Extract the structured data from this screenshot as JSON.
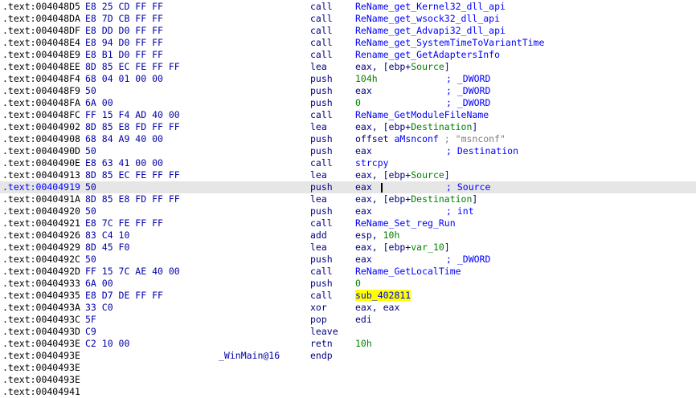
{
  "lines": [
    {
      "addr": ".text:004048D5",
      "bytes": "E8 25 CD FF FF",
      "mnem": "call",
      "ops": [
        {
          "t": "ReName_get_Kernel32_dll_api",
          "c": "blue"
        }
      ]
    },
    {
      "addr": ".text:004048DA",
      "bytes": "E8 7D CB FF FF",
      "mnem": "call",
      "ops": [
        {
          "t": "ReName_get_wsock32_dll_api",
          "c": "blue"
        }
      ]
    },
    {
      "addr": ".text:004048DF",
      "bytes": "E8 DD D0 FF FF",
      "mnem": "call",
      "ops": [
        {
          "t": "ReName_get_Advapi32_dll_api",
          "c": "blue"
        }
      ]
    },
    {
      "addr": ".text:004048E4",
      "bytes": "E8 94 D0 FF FF",
      "mnem": "call",
      "ops": [
        {
          "t": "ReName_get_SystemTimeToVariantTime",
          "c": "blue"
        }
      ]
    },
    {
      "addr": ".text:004048E9",
      "bytes": "E8 B1 D0 FF FF",
      "mnem": "call",
      "ops": [
        {
          "t": "Rename_get_GetAdaptersInfo",
          "c": "blue"
        }
      ]
    },
    {
      "addr": ".text:004048EE",
      "bytes": "8D 85 EC FE FF FF",
      "mnem": "lea",
      "ops": [
        {
          "t": "eax, [ebp+"
        },
        {
          "t": "Source",
          "c": "green"
        },
        {
          "t": "]"
        }
      ]
    },
    {
      "addr": ".text:004048F4",
      "bytes": "68 04 01 00 00",
      "mnem": "push",
      "ops": [
        {
          "t": "104h",
          "c": "green"
        }
      ],
      "cmt": "; _DWORD"
    },
    {
      "addr": ".text:004048F9",
      "bytes": "50",
      "mnem": "push",
      "ops": [
        {
          "t": "eax"
        }
      ],
      "cmt": "; _DWORD"
    },
    {
      "addr": ".text:004048FA",
      "bytes": "6A 00",
      "mnem": "push",
      "ops": [
        {
          "t": "0",
          "c": "green"
        }
      ],
      "cmt": "; _DWORD"
    },
    {
      "addr": ".text:004048FC",
      "bytes": "FF 15 F4 AD 40 00",
      "mnem": "call",
      "ops": [
        {
          "t": "ReName_GetModuleFileName",
          "c": "blue"
        }
      ]
    },
    {
      "addr": ".text:00404902",
      "bytes": "8D 85 E8 FD FF FF",
      "mnem": "lea",
      "ops": [
        {
          "t": "eax, [ebp+"
        },
        {
          "t": "Destination",
          "c": "green"
        },
        {
          "t": "]"
        }
      ]
    },
    {
      "addr": ".text:00404908",
      "bytes": "68 84 A9 40 00",
      "mnem": "push",
      "ops": [
        {
          "t": "offset "
        },
        {
          "t": "aMsnconf",
          "c": "blue"
        },
        {
          "t": " "
        },
        {
          "t": "; \"msnconf\"",
          "c": "grey"
        }
      ]
    },
    {
      "addr": ".text:0040490D",
      "bytes": "50",
      "mnem": "push",
      "ops": [
        {
          "t": "eax"
        }
      ],
      "cmt": "; Destination"
    },
    {
      "addr": ".text:0040490E",
      "bytes": "E8 63 41 00 00",
      "mnem": "call",
      "ops": [
        {
          "t": "strcpy",
          "c": "blue"
        }
      ]
    },
    {
      "addr": ".text:00404913",
      "bytes": "8D 85 EC FE FF FF",
      "mnem": "lea",
      "ops": [
        {
          "t": "eax, [ebp+"
        },
        {
          "t": "Source",
          "c": "green"
        },
        {
          "t": "]"
        }
      ]
    },
    {
      "addr": ".text:00404919",
      "bytes": "50",
      "mnem": "push",
      "ops": [
        {
          "t": "eax"
        }
      ],
      "cmt": "; Source",
      "current": true
    },
    {
      "addr": ".text:0040491A",
      "bytes": "8D 85 E8 FD FF FF",
      "mnem": "lea",
      "ops": [
        {
          "t": "eax, [ebp+"
        },
        {
          "t": "Destination",
          "c": "green"
        },
        {
          "t": "]"
        }
      ]
    },
    {
      "addr": ".text:00404920",
      "bytes": "50",
      "mnem": "push",
      "ops": [
        {
          "t": "eax"
        }
      ],
      "cmt": "; int"
    },
    {
      "addr": ".text:00404921",
      "bytes": "E8 7C FE FF FF",
      "mnem": "call",
      "ops": [
        {
          "t": "ReName_Set_reg_Run",
          "c": "blue"
        }
      ]
    },
    {
      "addr": ".text:00404926",
      "bytes": "83 C4 10",
      "mnem": "add",
      "ops": [
        {
          "t": "esp, "
        },
        {
          "t": "10h",
          "c": "green"
        }
      ]
    },
    {
      "addr": ".text:00404929",
      "bytes": "8D 45 F0",
      "mnem": "lea",
      "ops": [
        {
          "t": "eax, [ebp+"
        },
        {
          "t": "var_10",
          "c": "green"
        },
        {
          "t": "]"
        }
      ]
    },
    {
      "addr": ".text:0040492C",
      "bytes": "50",
      "mnem": "push",
      "ops": [
        {
          "t": "eax"
        }
      ],
      "cmt": "; _DWORD"
    },
    {
      "addr": ".text:0040492D",
      "bytes": "FF 15 7C AE 40 00",
      "mnem": "call",
      "ops": [
        {
          "t": "ReName_GetLocalTime",
          "c": "blue"
        }
      ]
    },
    {
      "addr": ".text:00404933",
      "bytes": "6A 00",
      "mnem": "push",
      "ops": [
        {
          "t": "0",
          "c": "green"
        }
      ]
    },
    {
      "addr": ".text:00404935",
      "bytes": "E8 D7 DE FF FF",
      "mnem": "call",
      "ops": [
        {
          "t": "sub_402811",
          "c": "blue",
          "hl": true
        }
      ]
    },
    {
      "addr": ".text:0040493A",
      "bytes": "33 C0",
      "mnem": "xor",
      "ops": [
        {
          "t": "eax, eax"
        }
      ]
    },
    {
      "addr": ".text:0040493C",
      "bytes": "5F",
      "mnem": "pop",
      "ops": [
        {
          "t": "edi"
        }
      ]
    },
    {
      "addr": ".text:0040493D",
      "bytes": "C9",
      "mnem": "leave",
      "ops": []
    },
    {
      "addr": ".text:0040493E",
      "bytes": "C2 10 00",
      "mnem": "retn",
      "ops": [
        {
          "t": "10h",
          "c": "green"
        }
      ]
    },
    {
      "addr": ".text:0040493E",
      "bytes": "",
      "label": "_WinMain@16",
      "mnem": "endp",
      "ops": []
    },
    {
      "addr": ".text:0040493E",
      "bytes": "",
      "mnem": "",
      "ops": []
    },
    {
      "addr": ".text:0040493E",
      "bytes": "",
      "mnem": "",
      "ops": []
    },
    {
      "addr": ".text:00404941",
      "bytes": "",
      "mnem": "",
      "ops": []
    }
  ],
  "colors": {
    "address": "#000000",
    "current_address": "#0000ff",
    "bytes": "#0000a8",
    "mnemonic": "#000080",
    "name_ref": "#0000ff",
    "stack_var": "#008000",
    "string_comment": "#808080",
    "highlight": "#ffff00",
    "current_line_bg": "#e6e6e6"
  }
}
